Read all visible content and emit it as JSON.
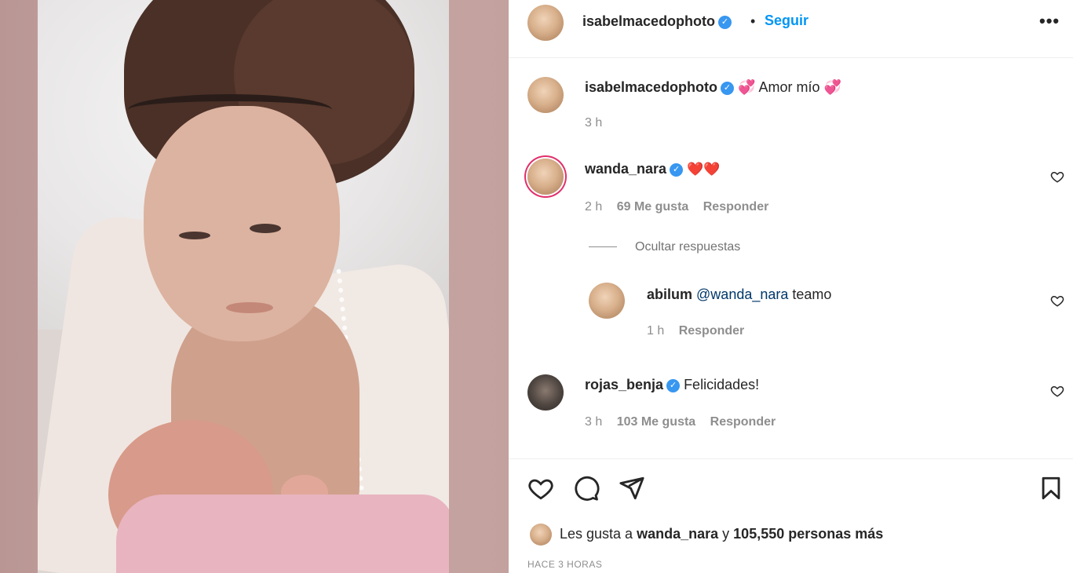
{
  "post": {
    "author": "isabelmacedophoto",
    "follow_label": "Seguir",
    "separator": "•",
    "more_label": "•••"
  },
  "caption": {
    "username": "isabelmacedophoto",
    "emoji_left": "💞",
    "text": "Amor mío",
    "emoji_right": "💞",
    "time": "3 h"
  },
  "comments": [
    {
      "username": "wanda_nara",
      "text": "❤️❤️",
      "time": "2 h",
      "likes": "69 Me gusta",
      "reply_label": "Responder"
    },
    {
      "username": "rojas_benja",
      "text": "Felicidades!",
      "time": "3 h",
      "likes": "103 Me gusta",
      "reply_label": "Responder"
    }
  ],
  "replies_toggle": "Ocultar respuestas",
  "reply": {
    "username": "abilum",
    "mention": "@wanda_nara",
    "text": "teamo",
    "time": "1 h",
    "reply_label": "Responder"
  },
  "likes_bar": {
    "prefix": "Les gusta a",
    "user": "wanda_nara",
    "middle": "y",
    "count": "105,550 personas más"
  },
  "timestamp": "HACE 3 HORAS",
  "icons": [
    "heart-icon",
    "comment-icon",
    "share-icon",
    "save-icon",
    "verified-icon",
    "more-icon"
  ],
  "colors": {
    "accent": "#0095f6",
    "verified": "#3897f0",
    "heart": "#d0161c"
  }
}
